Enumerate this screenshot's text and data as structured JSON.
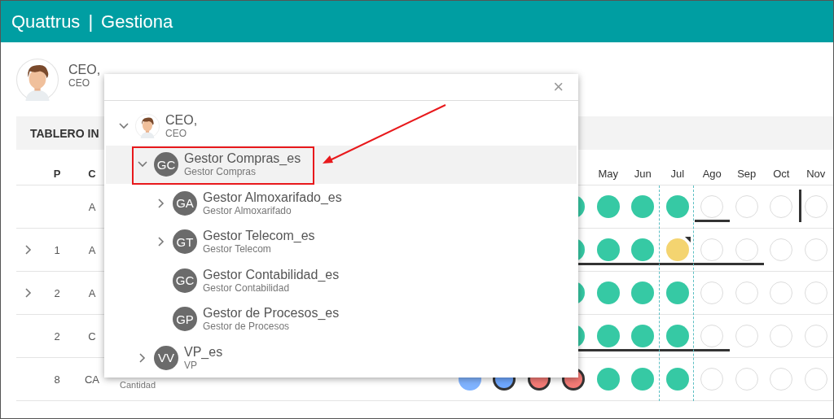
{
  "header": {
    "brand": "Quattrus",
    "separator": "|",
    "app": "Gestiona"
  },
  "profile": {
    "name": "CEO,",
    "role": "CEO"
  },
  "dashboard": {
    "title": "TABLERO IN",
    "columns": [
      "P",
      "C"
    ],
    "months": [
      {
        "label": "May",
        "current": false
      },
      {
        "label": "Jun",
        "current": false
      },
      {
        "label": "Jul",
        "current": true
      },
      {
        "label": "Ago",
        "current": false
      },
      {
        "label": "Sep",
        "current": false
      },
      {
        "label": "Oct",
        "current": false
      },
      {
        "label": "Nov",
        "current": false
      }
    ],
    "rows": [
      {
        "expandable": false,
        "c": "A",
        "cells": [
          {
            "kind": "filled",
            "color": "#36c9a4",
            "bar": false,
            "marker": false
          },
          {
            "kind": "filled",
            "color": "#36c9a4",
            "bar": false,
            "marker": false
          },
          {
            "kind": "filled",
            "color": "#36c9a4",
            "bar": false,
            "marker": false
          },
          {
            "kind": "filled",
            "color": "#36c9a4",
            "bar": false,
            "marker": false
          },
          {
            "kind": "empty",
            "bar": true,
            "marker": false
          },
          {
            "kind": "empty",
            "bar": false,
            "marker": false
          },
          {
            "kind": "empty",
            "bar": false,
            "marker": false
          },
          {
            "kind": "empty",
            "bar": false,
            "marker": true
          }
        ]
      },
      {
        "expandable": true,
        "p": "1",
        "c": "A",
        "cells": [
          {
            "kind": "filled",
            "color": "#36c9a4",
            "bar": true,
            "marker": false
          },
          {
            "kind": "filled",
            "color": "#36c9a4",
            "bar": true,
            "marker": false
          },
          {
            "kind": "filled",
            "color": "#36c9a4",
            "bar": true,
            "marker": false
          },
          {
            "kind": "flagged",
            "color": "#f4d470",
            "bar": true,
            "marker": false
          },
          {
            "kind": "empty",
            "bar": true,
            "marker": false
          },
          {
            "kind": "empty",
            "bar": true,
            "marker": false
          },
          {
            "kind": "empty",
            "bar": false,
            "marker": false
          },
          {
            "kind": "empty",
            "bar": false,
            "marker": false
          }
        ]
      },
      {
        "expandable": true,
        "p": "2",
        "c": "A",
        "cells": [
          {
            "kind": "filled",
            "color": "#36c9a4",
            "bar": false,
            "marker": false
          },
          {
            "kind": "filled",
            "color": "#36c9a4",
            "bar": false,
            "marker": false
          },
          {
            "kind": "filled",
            "color": "#36c9a4",
            "bar": false,
            "marker": false
          },
          {
            "kind": "filled",
            "color": "#36c9a4",
            "bar": false,
            "marker": false
          },
          {
            "kind": "empty",
            "bar": false,
            "marker": false
          },
          {
            "kind": "empty",
            "bar": false,
            "marker": false
          },
          {
            "kind": "empty",
            "bar": false,
            "marker": false
          },
          {
            "kind": "empty",
            "bar": false,
            "marker": false
          }
        ]
      },
      {
        "expandable": false,
        "p": "2",
        "c": "C",
        "cells": [
          {
            "kind": "filled",
            "color": "#36c9a4",
            "bar": true,
            "marker": false
          },
          {
            "kind": "filled",
            "color": "#36c9a4",
            "bar": true,
            "marker": false
          },
          {
            "kind": "filled",
            "color": "#36c9a4",
            "bar": true,
            "marker": false
          },
          {
            "kind": "filled",
            "color": "#36c9a4",
            "bar": true,
            "marker": false
          },
          {
            "kind": "empty",
            "bar": true,
            "marker": false
          },
          {
            "kind": "empty",
            "bar": false,
            "marker": false
          },
          {
            "kind": "empty",
            "bar": false,
            "marker": false
          },
          {
            "kind": "empty",
            "bar": false,
            "marker": false
          }
        ]
      },
      {
        "expandable": false,
        "p": "8",
        "c": "CA",
        "note": "Cantidad",
        "cells": [
          {
            "kind": "filled",
            "color": "#80b3ff",
            "bar": false,
            "marker": false
          },
          {
            "kind": "outlined",
            "color": "#6fa8ff",
            "bar": false,
            "marker": false
          },
          {
            "kind": "outlined",
            "color": "#f47b76",
            "bar": false,
            "marker": false
          },
          {
            "kind": "outlined",
            "color": "#f47b76",
            "bar": false,
            "marker": false
          },
          {
            "kind": "filled",
            "color": "#36c9a4",
            "bar": false,
            "marker": false
          },
          {
            "kind": "filled",
            "color": "#36c9a4",
            "bar": false,
            "marker": false
          },
          {
            "kind": "filled",
            "color": "#36c9a4",
            "bar": false,
            "marker": false
          },
          {
            "kind": "empty",
            "bar": false,
            "marker": false
          },
          {
            "kind": "empty",
            "bar": false,
            "marker": false
          },
          {
            "kind": "empty",
            "bar": false,
            "marker": false
          },
          {
            "kind": "empty",
            "bar": false,
            "marker": false
          }
        ]
      }
    ]
  },
  "dialog": {
    "close": "×",
    "tree": [
      {
        "name": "CEO,",
        "role": "CEO",
        "expandable": true,
        "expanded": true,
        "selected": false,
        "marked": false,
        "children": [
          {
            "initials": "GC",
            "name": "Gestor Compras_es",
            "role": "Gestor Compras",
            "expandable": true,
            "expanded": true,
            "selected": true,
            "marked": true,
            "children": [
              {
                "initials": "GA",
                "name": "Gestor Almoxarifado_es",
                "role": "Gestor Almoxarifado",
                "expandable": true,
                "expanded": false,
                "selected": false,
                "marked": false
              },
              {
                "initials": "GT",
                "name": "Gestor Telecom_es",
                "role": "Gestor Telecom",
                "expandable": true,
                "expanded": false,
                "selected": false,
                "marked": false
              },
              {
                "initials": "GC",
                "name": "Gestor Contabilidad_es",
                "role": "Gestor Contabilidad",
                "expandable": false,
                "selected": false,
                "marked": false
              },
              {
                "initials": "GP",
                "name": "Gestor de Procesos_es",
                "role": "Gestor de Procesos",
                "expandable": false,
                "selected": false,
                "marked": false
              }
            ]
          },
          {
            "initials": "VV",
            "name": "VP_es",
            "role": "VP",
            "expandable": true,
            "expanded": false,
            "selected": false,
            "marked": false
          }
        ]
      }
    ]
  }
}
